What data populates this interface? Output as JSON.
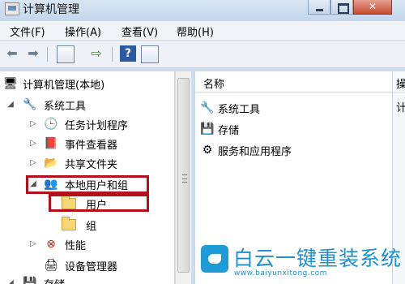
{
  "window": {
    "title": "计算机管理"
  },
  "menu": [
    {
      "label": "文件(F)"
    },
    {
      "label": "操作(A)"
    },
    {
      "label": "查看(V)"
    },
    {
      "label": "帮助(H)"
    }
  ],
  "tree": {
    "root": "计算机管理(本地)",
    "items": [
      {
        "label": "系统工具",
        "icon": "tools-icon"
      },
      {
        "label": "任务计划程序",
        "icon": "clock-icon"
      },
      {
        "label": "事件查看器",
        "icon": "event-viewer-icon"
      },
      {
        "label": "共享文件夹",
        "icon": "shared-folder-icon"
      },
      {
        "label": "本地用户和组",
        "icon": "users-group-icon"
      },
      {
        "label": "用户",
        "icon": "folder-icon"
      },
      {
        "label": "组",
        "icon": "folder-icon"
      },
      {
        "label": "性能",
        "icon": "performance-icon"
      },
      {
        "label": "设备管理器",
        "icon": "device-manager-icon"
      },
      {
        "label": "存储",
        "icon": "storage-icon"
      }
    ]
  },
  "list": {
    "column_header": "名称",
    "items": [
      {
        "label": "系统工具"
      },
      {
        "label": "存储"
      },
      {
        "label": "服务和应用程序"
      }
    ]
  },
  "actions": {
    "header": "操",
    "text": "计"
  },
  "watermark": {
    "title": "白云一键重装系统",
    "url": "www.baiyunxitong.com"
  },
  "colors": {
    "highlight": "#b5101a",
    "accent": "#1f8fd0"
  }
}
